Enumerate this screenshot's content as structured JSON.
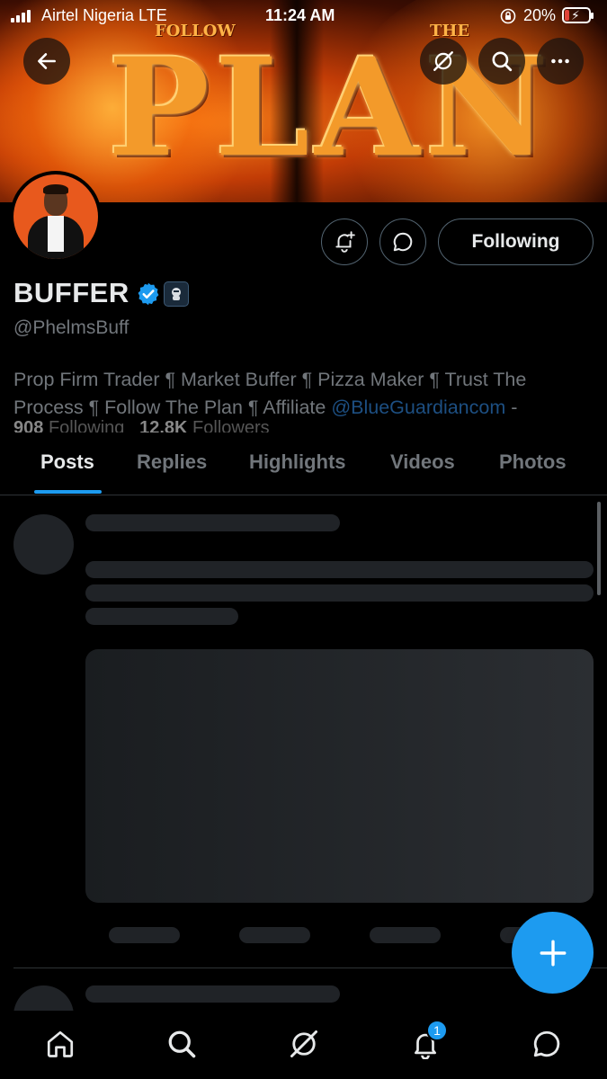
{
  "status_bar": {
    "carrier": "Airtel Nigeria  LTE",
    "time": "11:24 AM",
    "battery_percent": "20%",
    "battery_level": 0.2
  },
  "banner": {
    "word_main": "PLAN",
    "word_left": "FOLLOW",
    "word_right": "THE"
  },
  "header_buttons": {
    "back": "arrow-left-icon",
    "grok": "grok-icon",
    "search": "search-icon",
    "more": "more-icon"
  },
  "profile": {
    "display_name": "BUFFER",
    "handle": "@PhelmsBuff",
    "bio_text": "Prop Firm Trader ¶ Market Buffer ¶ Pizza Maker ¶ Trust The Process ¶ Follow The Plan ¶ Affiliate ",
    "bio_link": "@BlueGuardiancom",
    "bio_tail": " -",
    "following_count": "908",
    "following_label": "Following",
    "followers_count": "12.8K",
    "followers_label": "Followers"
  },
  "actions": {
    "following_label": "Following"
  },
  "tabs": [
    {
      "label": "Posts",
      "active": true
    },
    {
      "label": "Replies",
      "active": false
    },
    {
      "label": "Highlights",
      "active": false
    },
    {
      "label": "Videos",
      "active": false
    },
    {
      "label": "Photos",
      "active": false
    }
  ],
  "bottom_nav": {
    "items": [
      "home-icon",
      "search-icon",
      "grok-icon",
      "notifications-icon",
      "messages-icon"
    ],
    "notification_badge": "1"
  },
  "colors": {
    "accent": "#1d9bf0",
    "background": "#000000",
    "text_primary": "#e7e9ea",
    "text_secondary": "#71767b"
  }
}
